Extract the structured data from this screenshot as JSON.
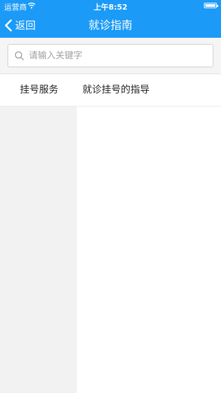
{
  "status_bar": {
    "carrier": "运营商",
    "time": "上午8:52"
  },
  "nav": {
    "back_label": "返回",
    "title": "就诊指南"
  },
  "search": {
    "placeholder": "请输入关键字",
    "value": ""
  },
  "tabs": [
    {
      "label": "挂号服务"
    },
    {
      "label": "就诊挂号的指导"
    }
  ],
  "colors": {
    "header_bg": "#1b9af7",
    "left_panel_bg": "#f2f2f2"
  }
}
